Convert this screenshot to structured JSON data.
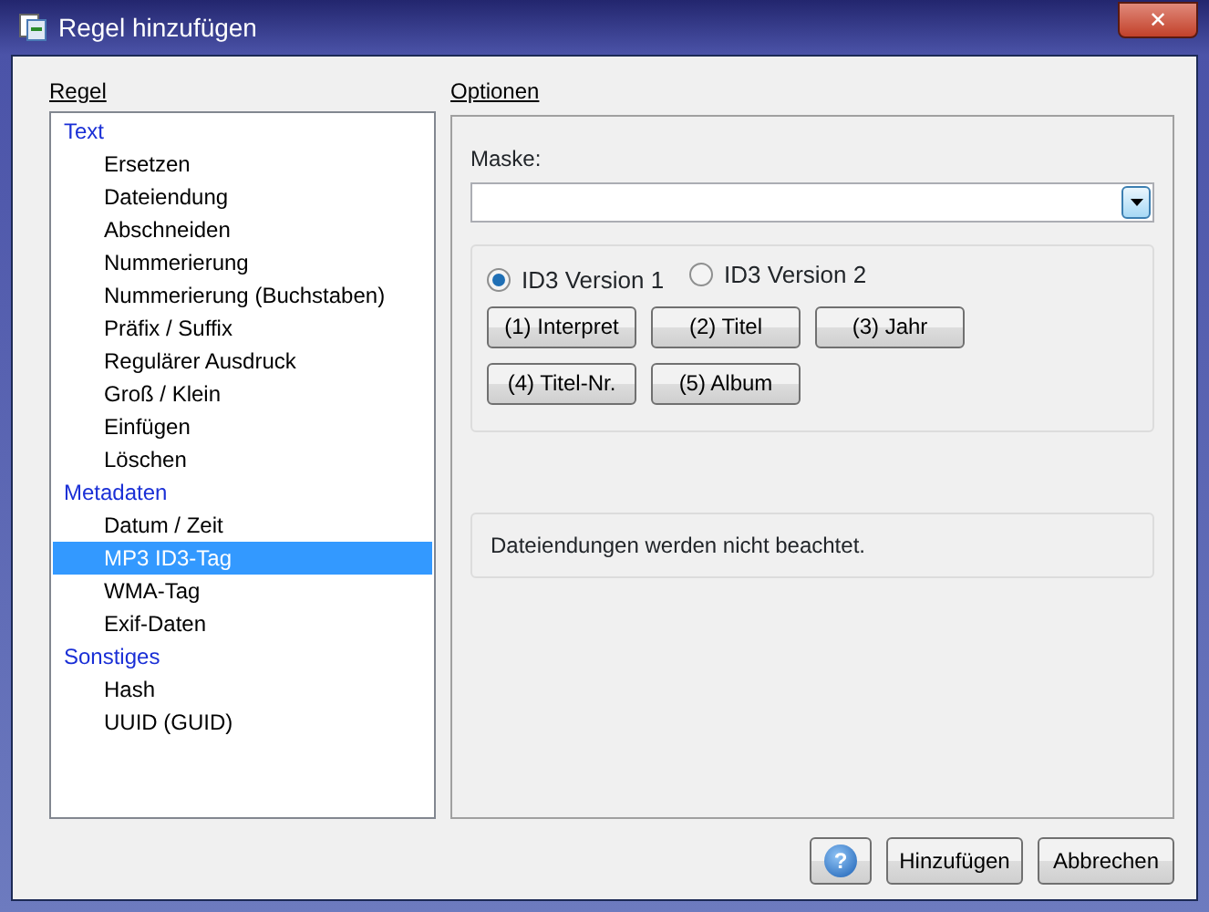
{
  "window": {
    "title": "Regel hinzufügen",
    "close_glyph": "✕"
  },
  "rules": {
    "label": "Regel",
    "categories": [
      {
        "label": "Text",
        "children": [
          {
            "label": "Ersetzen",
            "selected": false
          },
          {
            "label": "Dateiendung",
            "selected": false
          },
          {
            "label": "Abschneiden",
            "selected": false
          },
          {
            "label": "Nummerierung",
            "selected": false
          },
          {
            "label": "Nummerierung (Buchstaben)",
            "selected": false
          },
          {
            "label": "Präfix / Suffix",
            "selected": false
          },
          {
            "label": "Regulärer Ausdruck",
            "selected": false
          },
          {
            "label": "Groß / Klein",
            "selected": false
          },
          {
            "label": "Einfügen",
            "selected": false
          },
          {
            "label": "Löschen",
            "selected": false
          }
        ]
      },
      {
        "label": "Metadaten",
        "children": [
          {
            "label": "Datum / Zeit",
            "selected": false
          },
          {
            "label": "MP3 ID3-Tag",
            "selected": true
          },
          {
            "label": "WMA-Tag",
            "selected": false
          },
          {
            "label": "Exif-Daten",
            "selected": false
          }
        ]
      },
      {
        "label": "Sonstiges",
        "children": [
          {
            "label": "Hash",
            "selected": false
          },
          {
            "label": "UUID (GUID)",
            "selected": false
          }
        ]
      }
    ]
  },
  "options": {
    "label": "Optionen",
    "mask_label": "Maske:",
    "versions": [
      {
        "label": "ID3 Version 1",
        "selected": true
      },
      {
        "label": "ID3 Version 2",
        "selected": false
      }
    ],
    "tag_buttons": [
      [
        "(1) Interpret",
        "(2) Titel",
        "(3) Jahr"
      ],
      [
        "(4) Titel-Nr.",
        "(5) Album"
      ]
    ],
    "note": "Dateiendungen werden nicht beachtet."
  },
  "footer": {
    "help_glyph": "?",
    "buttons": [
      "Hinzufügen",
      "Abbrechen"
    ]
  }
}
